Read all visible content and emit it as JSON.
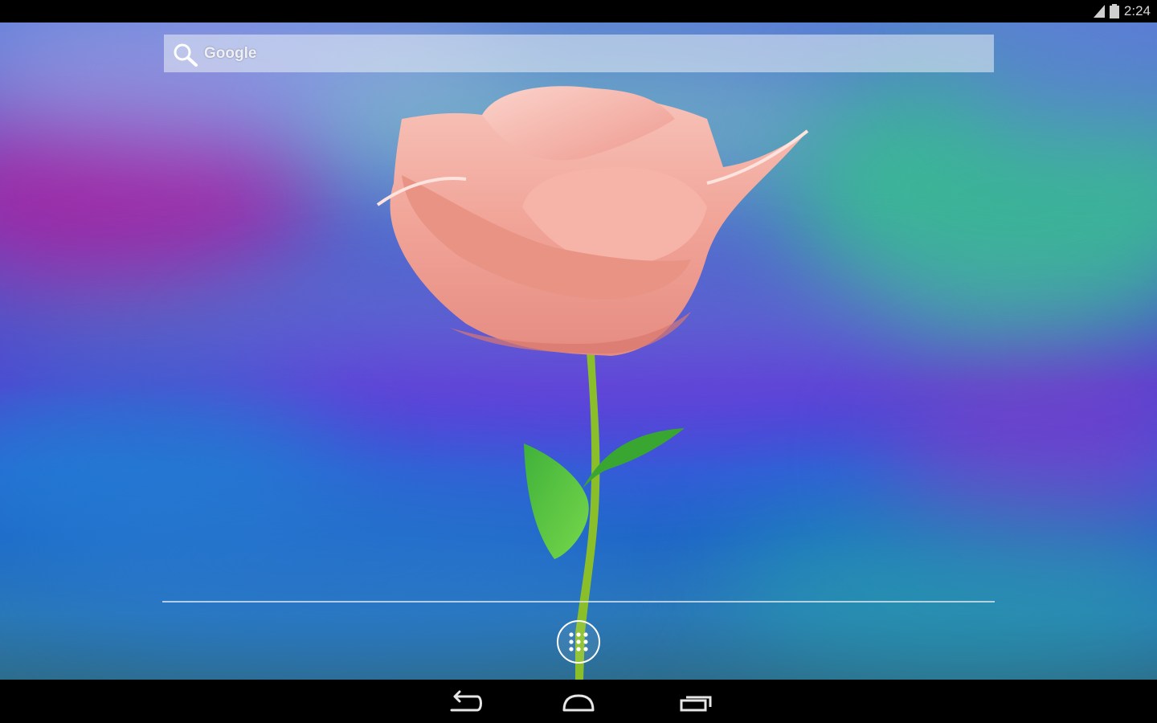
{
  "status_bar": {
    "time": "2:24",
    "icons": [
      "signal-icon",
      "battery-icon"
    ]
  },
  "search": {
    "label": "Google",
    "icon": "search-icon"
  },
  "wallpaper": {
    "subject": "rose",
    "petal_color": "#f2a89c",
    "leaf_color": "#4bc23a",
    "stem_color": "#8fbf2a"
  },
  "dock": {
    "all_apps_icon": "all-apps-icon"
  },
  "nav_bar": {
    "buttons": [
      "back-icon",
      "home-icon",
      "recents-icon"
    ]
  },
  "colors": {
    "status_bar_bg": "#000000",
    "nav_bar_bg": "#000000",
    "search_bar_bg": "#ebf0f5"
  }
}
